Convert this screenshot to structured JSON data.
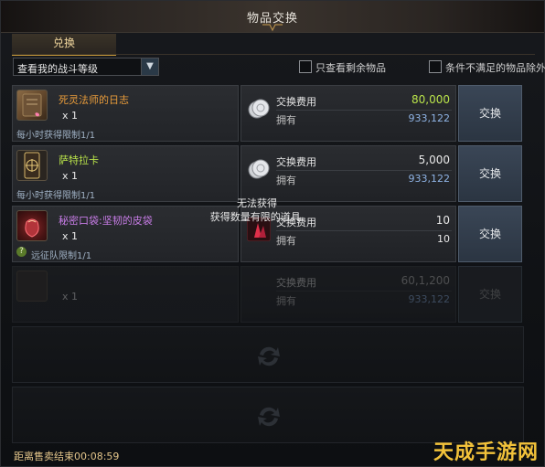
{
  "window": {
    "title": "物品交换"
  },
  "tabs": [
    {
      "label": "兑换"
    }
  ],
  "filter": {
    "select_value": "查看我的战斗等级",
    "checkbox_remaining": "只查看剩余物品",
    "checkbox_exclude": "条件不满足的物品除外"
  },
  "rows": [
    {
      "name": "死灵法师的日志",
      "name_color": "#e79b3a",
      "qty": "x 1",
      "limit": "每小时获得限制1/1",
      "cost_label": "交换费用",
      "cost_value": "80,000",
      "cost_color": "#b9e34a",
      "have_label": "拥有",
      "have_value": "933,122",
      "button": "交换",
      "currency_icon": "silver-coin-icon",
      "icon": "book-icon"
    },
    {
      "name": "萨特拉卡",
      "name_color": "#b9e34a",
      "qty": "x 1",
      "limit": "每小时获得限制1/1",
      "cost_label": "交换费用",
      "cost_value": "5,000",
      "cost_color": "#e8e8e8",
      "have_label": "拥有",
      "have_value": "933,122",
      "button": "交换",
      "currency_icon": "silver-coin-icon",
      "icon": "card-icon"
    },
    {
      "name": "秘密口袋:坚韧的皮袋",
      "name_color": "#c77ce6",
      "qty": "x 1",
      "limit": "远征队限制1/1",
      "cost_label": "交换费用",
      "cost_value": "10",
      "cost_color": "#e8e8e8",
      "have_label": "拥有",
      "have_value": "10",
      "button": "交换",
      "currency_icon": "red-crystal-icon",
      "icon": "pouch-icon"
    },
    {
      "name": "",
      "qty": "x 1",
      "limit": "",
      "cost_label": "交换费用",
      "cost_value": "60,1,200",
      "have_label": "拥有",
      "have_value": "933,122",
      "button": "交换",
      "disabled": true
    }
  ],
  "tooltip": {
    "line1": "无法获得",
    "line2": "获得数量有限的道具."
  },
  "footer": {
    "timer": "距离售卖结束00:08:59"
  },
  "watermark": "天成手游网",
  "colors": {
    "accent": "#c99a3a",
    "button": "#3a4656"
  }
}
